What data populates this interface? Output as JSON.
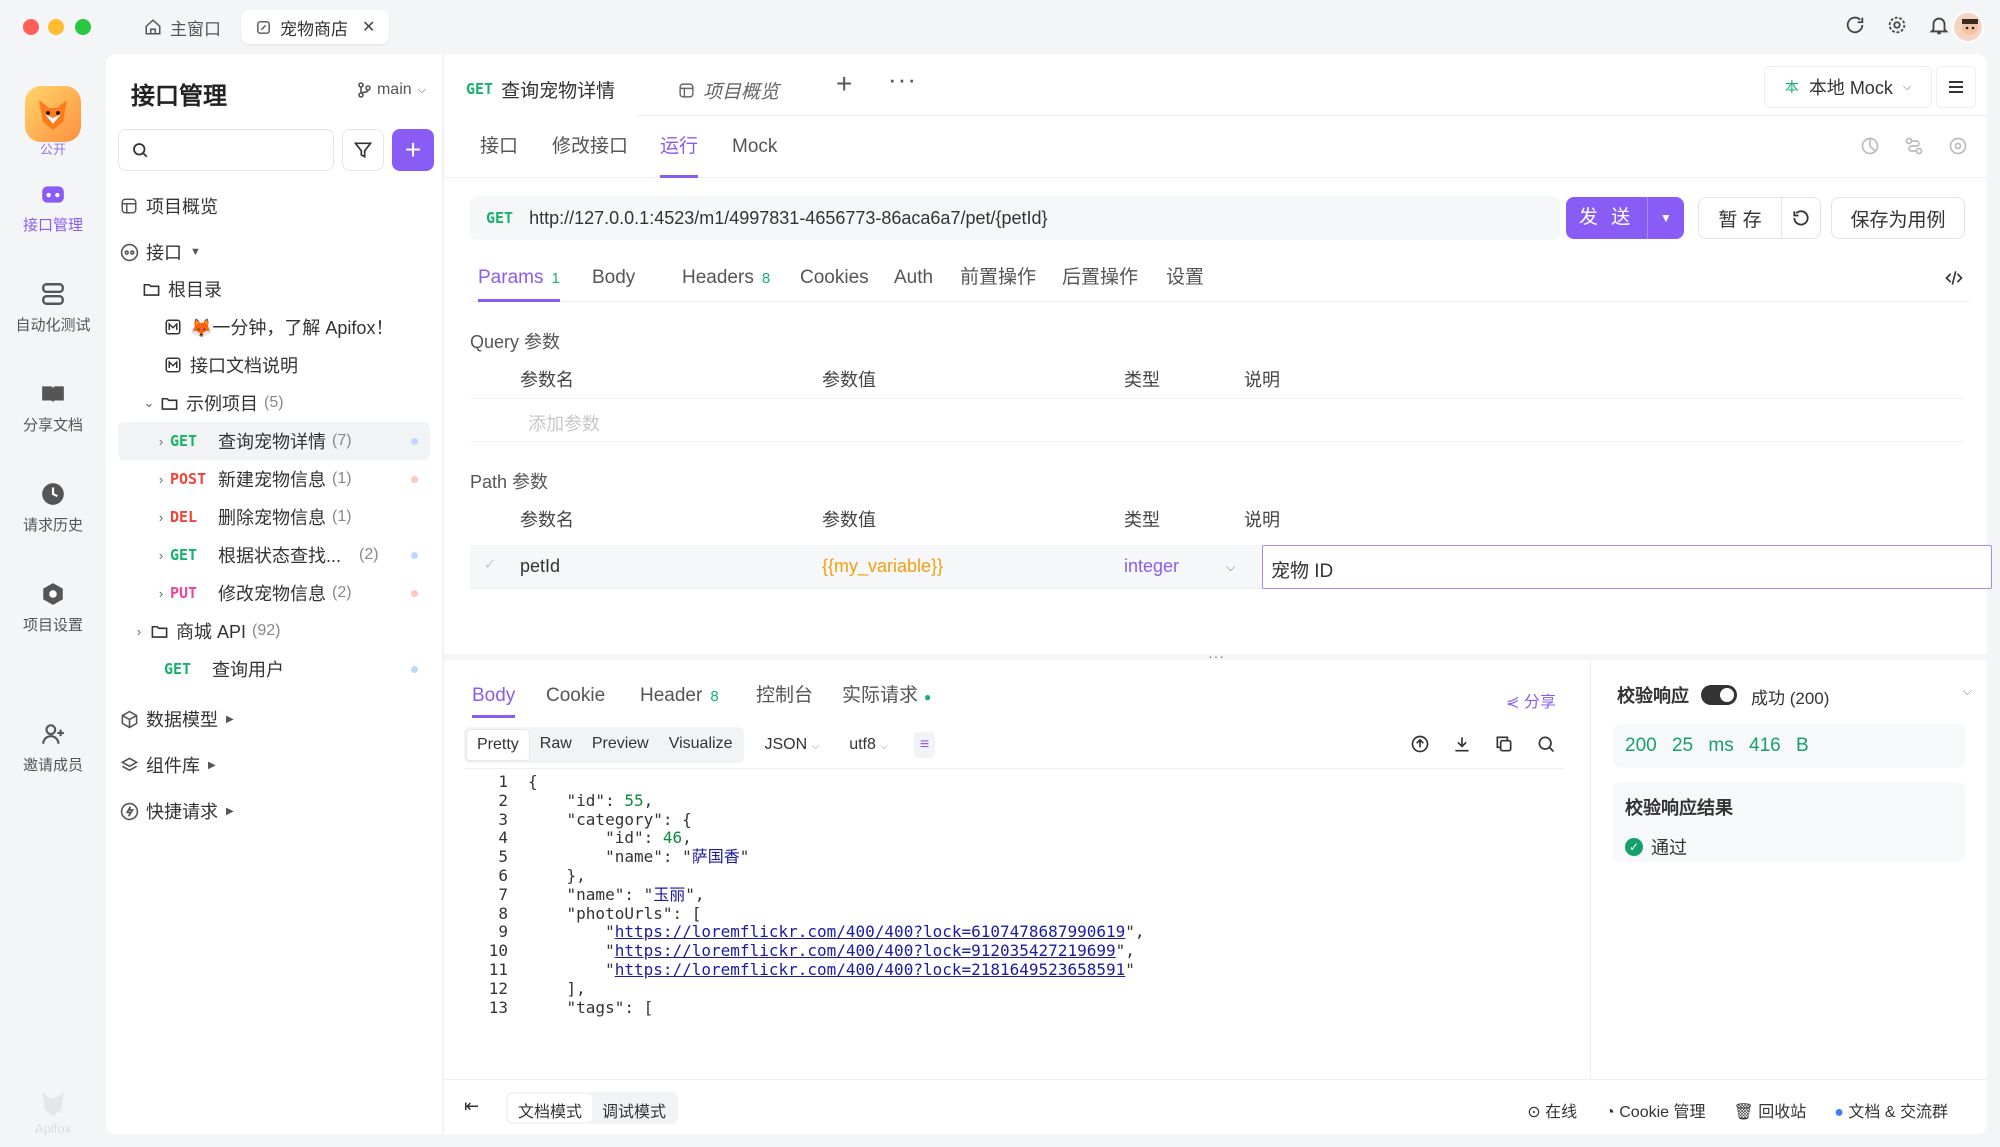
{
  "window": {
    "tabs": [
      {
        "label": "主窗口"
      },
      {
        "label": "宠物商店"
      }
    ]
  },
  "rail": {
    "public_label": "公开",
    "items": [
      {
        "label": "接口管理"
      },
      {
        "label": "自动化测试"
      },
      {
        "label": "分享文档"
      },
      {
        "label": "请求历史"
      },
      {
        "label": "项目设置"
      },
      {
        "label": "邀请成员"
      }
    ],
    "brand": "Apifox"
  },
  "sidebar": {
    "title": "接口管理",
    "branch": "main",
    "tree": {
      "overview": "项目概览",
      "api_root": "接口",
      "root_dir": "根目录",
      "doc1": "🦊一分钟，了解 Apifox！",
      "doc2": "接口文档说明",
      "folder": "示例项目",
      "folder_count": "(5)",
      "endpoints": [
        {
          "method": "GET",
          "name": "查询宠物详情",
          "count": "(7)"
        },
        {
          "method": "POST",
          "name": "新建宠物信息",
          "count": "(1)"
        },
        {
          "method": "DEL",
          "name": "删除宠物信息",
          "count": "(1)"
        },
        {
          "method": "GET",
          "name": "根据状态查找...",
          "count": "(2)"
        },
        {
          "method": "PUT",
          "name": "修改宠物信息",
          "count": "(2)"
        }
      ],
      "mall": "商城 API",
      "mall_count": "(92)",
      "user_method": "GET",
      "user_name": "查询用户",
      "data_model": "数据模型",
      "components": "组件库",
      "quick": "快捷请求"
    }
  },
  "main": {
    "tab_active_method": "GET",
    "tab_active_label": "查询宠物详情",
    "tab_overview": "项目概览",
    "mock_env": "本地 Mock",
    "subtabs": [
      "接口",
      "修改接口",
      "运行",
      "Mock"
    ],
    "url_method": "GET",
    "url": "http://127.0.0.1:4523/m1/4997831-4656773-86aca6a7/pet/{petId}",
    "send": "发 送",
    "save_temp": "暂 存",
    "save_case": "保存为用例",
    "param_tabs": [
      {
        "label": "Params",
        "n": "1"
      },
      {
        "label": "Body",
        "n": ""
      },
      {
        "label": "Headers",
        "n": "8"
      },
      {
        "label": "Cookies",
        "n": ""
      },
      {
        "label": "Auth",
        "n": ""
      },
      {
        "label": "前置操作",
        "n": ""
      },
      {
        "label": "后置操作",
        "n": ""
      },
      {
        "label": "设置",
        "n": ""
      }
    ],
    "query_title": "Query 参数",
    "path_title": "Path 参数",
    "headers": {
      "name": "参数名",
      "value": "参数值",
      "type": "类型",
      "desc": "说明"
    },
    "add_param": "添加参数",
    "path_row": {
      "name": "petId",
      "value": "{{my_variable}}",
      "type": "integer",
      "desc": "宠物 ID"
    }
  },
  "response": {
    "tabs": [
      {
        "label": "Body",
        "n": ""
      },
      {
        "label": "Cookie",
        "n": ""
      },
      {
        "label": "Header",
        "n": "8"
      },
      {
        "label": "控制台",
        "n": ""
      },
      {
        "label": "实际请求",
        "n": ""
      }
    ],
    "share": "分享",
    "formats": [
      "Pretty",
      "Raw",
      "Preview",
      "Visualize"
    ],
    "lang": "JSON",
    "encoding": "utf8",
    "code_lines": [
      "{",
      "    \"id\": 55,",
      "    \"category\": {",
      "        \"id\": 46,",
      "        \"name\": \"萨国香\"",
      "    },",
      "    \"name\": \"玉丽\",",
      "    \"photoUrls\": [",
      "        \"https://loremflickr.com/400/400?lock=6107478687990619\",",
      "        \"https://loremflickr.com/400/400?lock=912035427219699\",",
      "        \"https://loremflickr.com/400/400?lock=2181649523658591\"",
      "    ],",
      "    \"tags\": ["
    ]
  },
  "validation": {
    "title": "校验响应",
    "status": "成功 (200)",
    "stats": "200  25 ms  416 B",
    "result_title": "校验响应结果",
    "result": "通过"
  },
  "footer": {
    "modes": [
      "文档模式",
      "调试模式"
    ],
    "online": "在线",
    "cookie": "Cookie 管理",
    "trash": "回收站",
    "docs": "文档 & 交流群"
  },
  "colors": {
    "accent": "#8a5cf6",
    "get": "#17b26a",
    "post": "#f04438",
    "put": "#ec4899"
  }
}
